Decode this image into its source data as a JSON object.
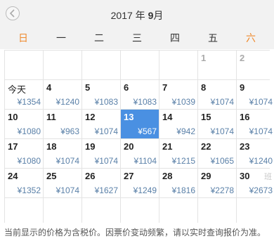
{
  "header": {
    "year_label": "2017 年",
    "month_number": "9",
    "month_suffix": "月"
  },
  "weekdays": [
    "日",
    "一",
    "二",
    "三",
    "四",
    "五",
    "六"
  ],
  "days": [
    {
      "day": "",
      "price": ""
    },
    {
      "day": "",
      "price": ""
    },
    {
      "day": "",
      "price": ""
    },
    {
      "day": "",
      "price": ""
    },
    {
      "day": "",
      "price": ""
    },
    {
      "day": "1",
      "price": ""
    },
    {
      "day": "2",
      "price": ""
    },
    {
      "day": "今天",
      "price": "¥1354"
    },
    {
      "day": "4",
      "price": "¥1240"
    },
    {
      "day": "5",
      "price": "¥1083"
    },
    {
      "day": "6",
      "price": "¥1083"
    },
    {
      "day": "7",
      "price": "¥1039"
    },
    {
      "day": "8",
      "price": "¥1074"
    },
    {
      "day": "9",
      "price": "¥1074"
    },
    {
      "day": "10",
      "price": "¥1080"
    },
    {
      "day": "11",
      "price": "¥963"
    },
    {
      "day": "12",
      "price": "¥1074"
    },
    {
      "day": "13",
      "price": "¥567"
    },
    {
      "day": "14",
      "price": "¥942"
    },
    {
      "day": "15",
      "price": "¥1074"
    },
    {
      "day": "16",
      "price": "¥1074"
    },
    {
      "day": "17",
      "price": "¥1080"
    },
    {
      "day": "18",
      "price": "¥1074"
    },
    {
      "day": "19",
      "price": "¥1074"
    },
    {
      "day": "20",
      "price": "¥1104"
    },
    {
      "day": "21",
      "price": "¥1215"
    },
    {
      "day": "22",
      "price": "¥1065"
    },
    {
      "day": "23",
      "price": "¥1240"
    },
    {
      "day": "24",
      "price": "¥1352"
    },
    {
      "day": "25",
      "price": "¥1074"
    },
    {
      "day": "26",
      "price": "¥1627"
    },
    {
      "day": "27",
      "price": "¥1249"
    },
    {
      "day": "28",
      "price": "¥1816"
    },
    {
      "day": "29",
      "price": "¥2278"
    },
    {
      "day": "30",
      "price": "¥2673",
      "tag": "班"
    },
    {
      "day": "",
      "price": ""
    },
    {
      "day": "",
      "price": ""
    },
    {
      "day": "",
      "price": ""
    },
    {
      "day": "",
      "price": ""
    },
    {
      "day": "",
      "price": ""
    },
    {
      "day": "",
      "price": ""
    },
    {
      "day": "",
      "price": ""
    }
  ],
  "selected_day": "13",
  "footer_note": "当前显示的价格为含税价。因票价变动频繁，请以实时查询报价为准。",
  "colors": {
    "weekend": "#ef8a2e",
    "selected_bg": "#4a90e2",
    "price": "#5a80a8"
  }
}
